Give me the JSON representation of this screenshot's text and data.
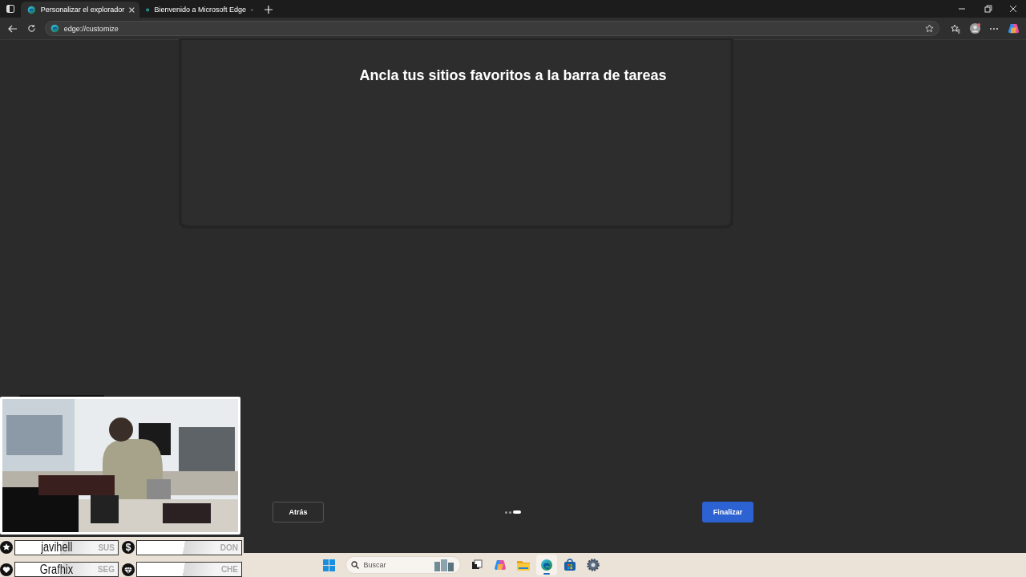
{
  "tabs": [
    {
      "title": "Personalizar el explorador",
      "selected": true
    },
    {
      "title": "Bienvenido a Microsoft Edge",
      "selected": false
    }
  ],
  "address_bar": {
    "url": "edge://customize"
  },
  "page": {
    "heading": "Ancla tus sitios favoritos a la barra de tareas",
    "back_button": "Atrás",
    "finish_button": "Finalizar",
    "steps": [
      {
        "selected": false
      },
      {
        "selected": false
      },
      {
        "selected": true
      }
    ]
  },
  "stream_overlay": {
    "stats": [
      {
        "kind": "star",
        "name": "javihell",
        "tag": "SUS"
      },
      {
        "kind": "symbol",
        "symbol": "$",
        "tag": "DON"
      },
      {
        "kind": "heart",
        "name": "Grafhix",
        "tag": "SEG"
      },
      {
        "kind": "gem",
        "tag": "CHE"
      }
    ]
  },
  "taskbar": {
    "search": {
      "placeholder": "Buscar"
    },
    "apps": [
      {
        "kind": "task-view",
        "selected": false
      },
      {
        "kind": "copilot",
        "selected": false
      },
      {
        "kind": "folder",
        "selected": false
      },
      {
        "kind": "edge",
        "selected": true
      },
      {
        "kind": "store",
        "selected": false
      },
      {
        "kind": "settings",
        "selected": false
      }
    ]
  }
}
